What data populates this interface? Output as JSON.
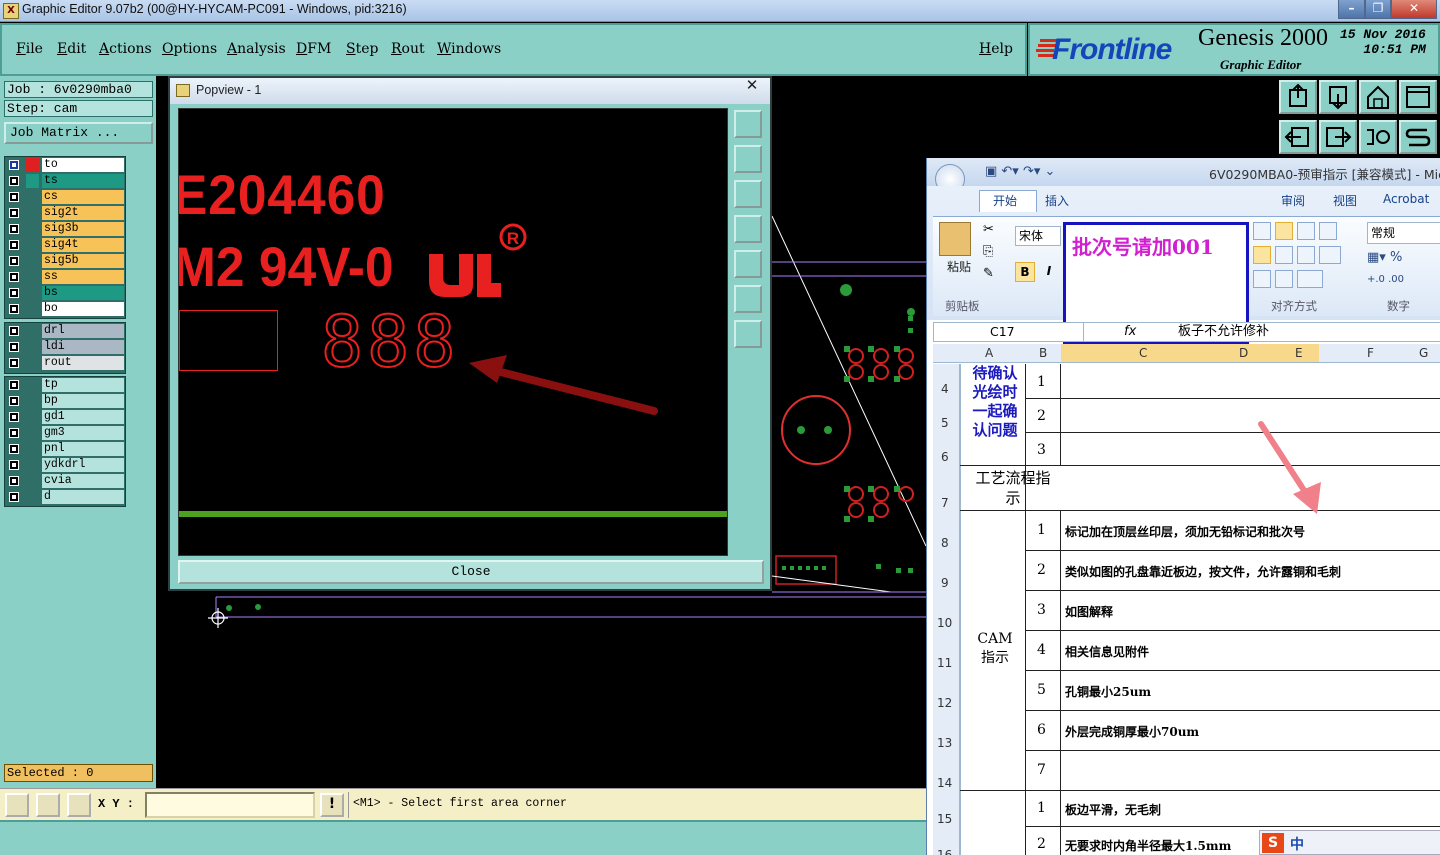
{
  "window": {
    "title": "Graphic Editor 9.07b2 (00@HY-HYCAM-PC091 - Windows, pid:3216)",
    "icon": "X"
  },
  "menu": {
    "items": [
      "File",
      "Edit",
      "Actions",
      "Options",
      "Analysis",
      "DFM",
      "Step",
      "Rout",
      "Windows"
    ],
    "help": "Help"
  },
  "logo": {
    "brand": "Frontline",
    "product": "Genesis 2000",
    "subtitle": "Graphic Editor",
    "date": "15 Nov 2016",
    "time": "10:51 PM"
  },
  "job": {
    "job_label": "Job : 6v0290mba0",
    "step_label": "Step: cam",
    "matrix_button": "Job Matrix ..."
  },
  "layers": {
    "group1": [
      {
        "name": "to",
        "color": "#ffffff"
      },
      {
        "name": "ts",
        "color": "#1e9a84"
      },
      {
        "name": "cs",
        "color": "#f7c257"
      },
      {
        "name": "sig2t",
        "color": "#f7c257"
      },
      {
        "name": "sig3b",
        "color": "#f7c257"
      },
      {
        "name": "sig4t",
        "color": "#f7c257"
      },
      {
        "name": "sig5b",
        "color": "#f7c257"
      },
      {
        "name": "ss",
        "color": "#f7c257"
      },
      {
        "name": "bs",
        "color": "#1e9a84"
      },
      {
        "name": "bo",
        "color": "#ffffff"
      }
    ],
    "group2": [
      {
        "name": "drl",
        "color": "#a9b8c4"
      },
      {
        "name": "ldi",
        "color": "#a9b8c4"
      },
      {
        "name": "rout",
        "color": "#dfe3e6"
      }
    ],
    "group3": [
      {
        "name": "tp",
        "color": "#b4e2dc"
      },
      {
        "name": "bp",
        "color": "#b4e2dc"
      },
      {
        "name": "gd1",
        "color": "#b4e2dc"
      },
      {
        "name": "gm3",
        "color": "#b4e2dc"
      },
      {
        "name": "pnl",
        "color": "#b4e2dc"
      },
      {
        "name": "ydkdrl",
        "color": "#b4e2dc"
      },
      {
        "name": "cvia",
        "color": "#b4e2dc"
      },
      {
        "name": "d",
        "color": "#b4e2dc"
      }
    ]
  },
  "status": {
    "selected": "Selected : 0",
    "xy_label": "X Y :",
    "xy_value": "",
    "prompt": "<M1> - Select first area corner"
  },
  "popview": {
    "title": "Popview - 1",
    "line1": "E204460",
    "line2": "M2 94V-0",
    "ul_mark": "R",
    "digits": "888",
    "close_label": "Close"
  },
  "excel": {
    "title": "6V0290MBA0-预审指示 [兼容模式] - Mic",
    "tabs": [
      "开始",
      "插入",
      "审阅",
      "视图",
      "Acrobat"
    ],
    "note": "批次号请加001",
    "font_name": "宋体",
    "paste_label": "粘贴",
    "clipboard_label": "剪贴板",
    "align_label": "对齐方式",
    "number_label": "数字",
    "number_format": "常规",
    "cell_ref": "C17",
    "formula": "板子不允许修补",
    "columns": [
      "A",
      "B",
      "C",
      "D",
      "E",
      "F",
      "G"
    ],
    "rows": [
      "4",
      "5",
      "6",
      "7",
      "8",
      "9",
      "10",
      "11",
      "12",
      "13",
      "14",
      "15",
      "16"
    ],
    "section1_label": "待确认光绘时一起确认问题",
    "section2_label": "工艺流程指示",
    "section3_label": "CAM指示",
    "items_section1": [
      "1",
      "2",
      "3"
    ],
    "items_cam": [
      {
        "n": "1",
        "text": "标记加在顶层丝印层，须加无铅标记和批次号"
      },
      {
        "n": "2",
        "text": "类似如图的孔盘靠近板边，按文件，允许露铜和毛刺"
      },
      {
        "n": "3",
        "text": "如图解释"
      },
      {
        "n": "4",
        "text": "相关信息见附件"
      },
      {
        "n": "5",
        "text": "孔铜最小25um"
      },
      {
        "n": "6",
        "text": "外层完成铜厚最小70um"
      },
      {
        "n": "7",
        "text": ""
      }
    ],
    "items_last": [
      {
        "n": "1",
        "text": "板边平滑，无毛刺"
      },
      {
        "n": "2",
        "text": "无要求时内角半径最大1.5mm"
      }
    ],
    "ime": "中"
  }
}
